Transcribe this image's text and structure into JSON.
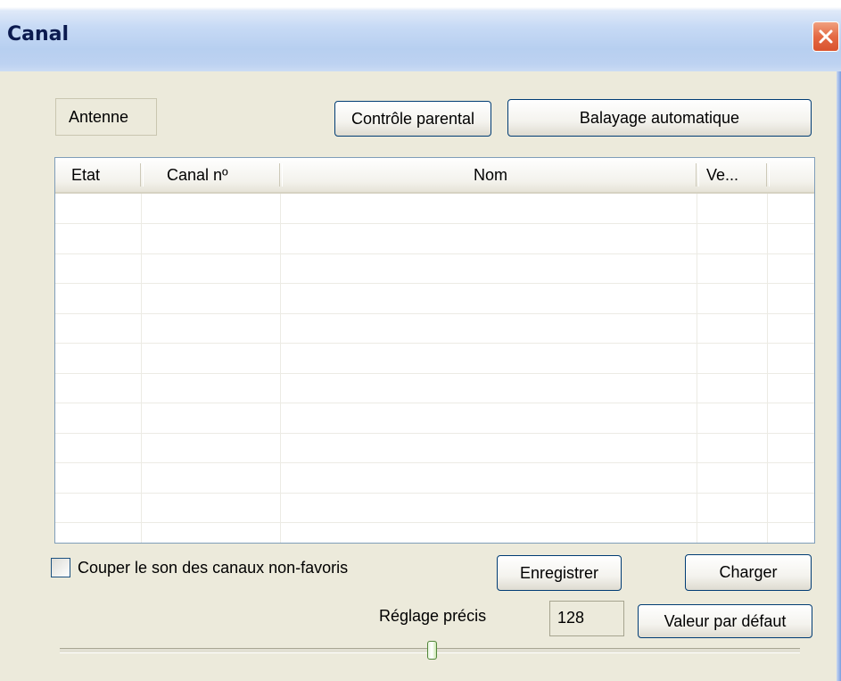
{
  "window": {
    "title": "Canal"
  },
  "source_label": "Antenne",
  "buttons": {
    "parental": "Contrôle parental",
    "autoscan": "Balayage automatique",
    "save": "Enregistrer",
    "load": "Charger",
    "default": "Valeur par défaut"
  },
  "list": {
    "columns": [
      "Etat",
      "Canal nº",
      "Nom",
      "Ve..."
    ],
    "rows": []
  },
  "mute_checkbox": {
    "label": "Couper le son des canaux non-favoris",
    "checked": false
  },
  "fine_tuning": {
    "label": "Réglage précis",
    "value": "128"
  },
  "icons": {
    "close": "close-icon"
  },
  "colors": {
    "title_text": "#0b1a4f",
    "close_button": "#e46a44",
    "dialog_bg": "#eceadb"
  }
}
